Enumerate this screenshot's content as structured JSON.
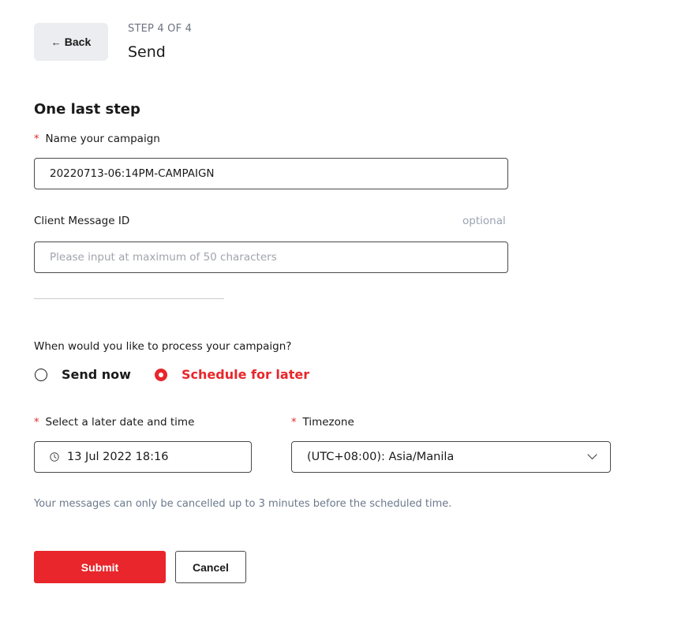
{
  "header": {
    "back_label": "Back",
    "back_icon": "arrow-left-icon",
    "step_label": "STEP 4 OF 4",
    "step_title": "Send"
  },
  "form": {
    "section_title": "One last step",
    "campaign_name": {
      "label": "Name your campaign",
      "required_mark": "*",
      "value": "20220713-06:14PM-CAMPAIGN"
    },
    "client_message_id": {
      "label": "Client Message ID",
      "optional_label": "optional",
      "placeholder": "Please input at maximum of 50 characters",
      "value": ""
    },
    "process_question": "When would you like to process your campaign?",
    "process_options": [
      {
        "label": "Send now",
        "selected": false
      },
      {
        "label": "Schedule for later",
        "selected": true
      }
    ],
    "schedule_datetime": {
      "label": "Select a later date and time",
      "required_mark": "*",
      "value": "13 Jul 2022 18:16",
      "icon": "clock-icon"
    },
    "timezone": {
      "label": "Timezone",
      "required_mark": "*",
      "value": "(UTC+08:00): Asia/Manila",
      "icon": "chevron-down-icon"
    },
    "notice": "Your messages can only be cancelled up to 3 minutes before the scheduled time."
  },
  "actions": {
    "submit_label": "Submit",
    "cancel_label": "Cancel"
  },
  "colors": {
    "accent": "#e8262b",
    "muted_text": "#6b7a8c",
    "back_button_bg": "#ebedf0"
  }
}
